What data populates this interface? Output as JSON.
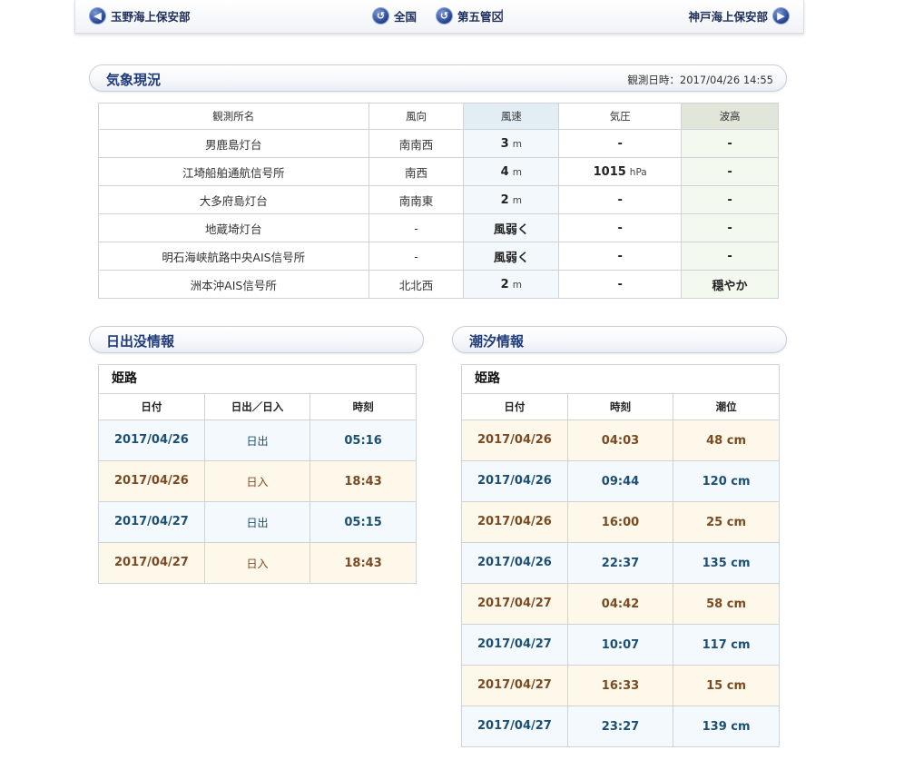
{
  "nav": {
    "prev": "玉野海上保安部",
    "all": "全国",
    "separator": "|",
    "district": "第五管区",
    "next": "神戸海上保安部"
  },
  "weather": {
    "title": "気象現況",
    "observed": "観測日時：2017/04/26 14:55",
    "headers": [
      "観測所名",
      "風向",
      "風速",
      "気圧",
      "波高"
    ],
    "rows": [
      {
        "name": "男鹿島灯台",
        "dir": "南南西",
        "speed": "3",
        "speed_unit": "m",
        "pressure": "-",
        "pressure_unit": "",
        "wave": "-"
      },
      {
        "name": "江埼船舶通航信号所",
        "dir": "南西",
        "speed": "4",
        "speed_unit": "m",
        "pressure": "1015",
        "pressure_unit": "hPa",
        "wave": "-"
      },
      {
        "name": "大多府島灯台",
        "dir": "南南東",
        "speed": "2",
        "speed_unit": "m",
        "pressure": "-",
        "pressure_unit": "",
        "wave": "-"
      },
      {
        "name": "地蔵埼灯台",
        "dir": "-",
        "speed": "風弱く",
        "speed_unit": "",
        "pressure": "-",
        "pressure_unit": "",
        "wave": "-"
      },
      {
        "name": "明石海峡航路中央AIS信号所",
        "dir": "-",
        "speed": "風弱く",
        "speed_unit": "",
        "pressure": "-",
        "pressure_unit": "",
        "wave": "-"
      },
      {
        "name": "洲本沖AIS信号所",
        "dir": "北北西",
        "speed": "2",
        "speed_unit": "m",
        "pressure": "-",
        "pressure_unit": "",
        "wave": "穏やか"
      }
    ]
  },
  "sun": {
    "title": "日出没情報",
    "location": "姫路",
    "headers": [
      "日付",
      "日出／日入",
      "時刻"
    ],
    "rows": [
      {
        "date": "2017/04/26",
        "event": "日出",
        "time": "05:16",
        "tone": "blue"
      },
      {
        "date": "2017/04/26",
        "event": "日入",
        "time": "18:43",
        "tone": "tan"
      },
      {
        "date": "2017/04/27",
        "event": "日出",
        "time": "05:15",
        "tone": "blue"
      },
      {
        "date": "2017/04/27",
        "event": "日入",
        "time": "18:43",
        "tone": "tan"
      }
    ]
  },
  "tide": {
    "title": "潮汐情報",
    "location": "姫路",
    "headers": [
      "日付",
      "時刻",
      "潮位"
    ],
    "rows": [
      {
        "date": "2017/04/26",
        "time": "04:03",
        "level": "48 cm",
        "tone": "tan"
      },
      {
        "date": "2017/04/26",
        "time": "09:44",
        "level": "120 cm",
        "tone": "blue"
      },
      {
        "date": "2017/04/26",
        "time": "16:00",
        "level": "25 cm",
        "tone": "tan"
      },
      {
        "date": "2017/04/26",
        "time": "22:37",
        "level": "135 cm",
        "tone": "blue"
      },
      {
        "date": "2017/04/27",
        "time": "04:42",
        "level": "58 cm",
        "tone": "tan"
      },
      {
        "date": "2017/04/27",
        "time": "10:07",
        "level": "117 cm",
        "tone": "blue"
      },
      {
        "date": "2017/04/27",
        "time": "16:33",
        "level": "15 cm",
        "tone": "tan"
      },
      {
        "date": "2017/04/27",
        "time": "23:27",
        "level": "139 cm",
        "tone": "blue"
      }
    ]
  },
  "colors": {
    "heading_navy": "#1f3b7a",
    "tone_blue_bg": "#f3f9fc",
    "tone_blue_text": "#1d4f73",
    "tone_tan_bg": "#fdf8ea",
    "tone_tan_text": "#7a4a22",
    "wind_speed_header": "#e3eef4",
    "wave_header": "#e0e6d9"
  },
  "icons": {
    "prev": "arrow-left-circle-icon",
    "all": "return-circle-icon",
    "district": "return-circle-icon",
    "next": "arrow-right-circle-icon"
  }
}
